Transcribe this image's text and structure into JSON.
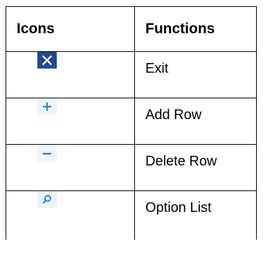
{
  "table": {
    "headers": {
      "icons": "Icons",
      "functions": "Functions"
    },
    "rows": [
      {
        "icon": "close-icon",
        "function": "Exit"
      },
      {
        "icon": "plus-icon",
        "function": "Add Row"
      },
      {
        "icon": "minus-icon",
        "function": "Delete Row"
      },
      {
        "icon": "search-icon",
        "function": "Option List"
      }
    ]
  },
  "colors": {
    "exit_bg": "#1F4A8C",
    "exit_glyph": "#FFFFFF",
    "light_bg": "#EEF4FB",
    "light_glyph": "#2E7FD6",
    "border": "#000000"
  }
}
